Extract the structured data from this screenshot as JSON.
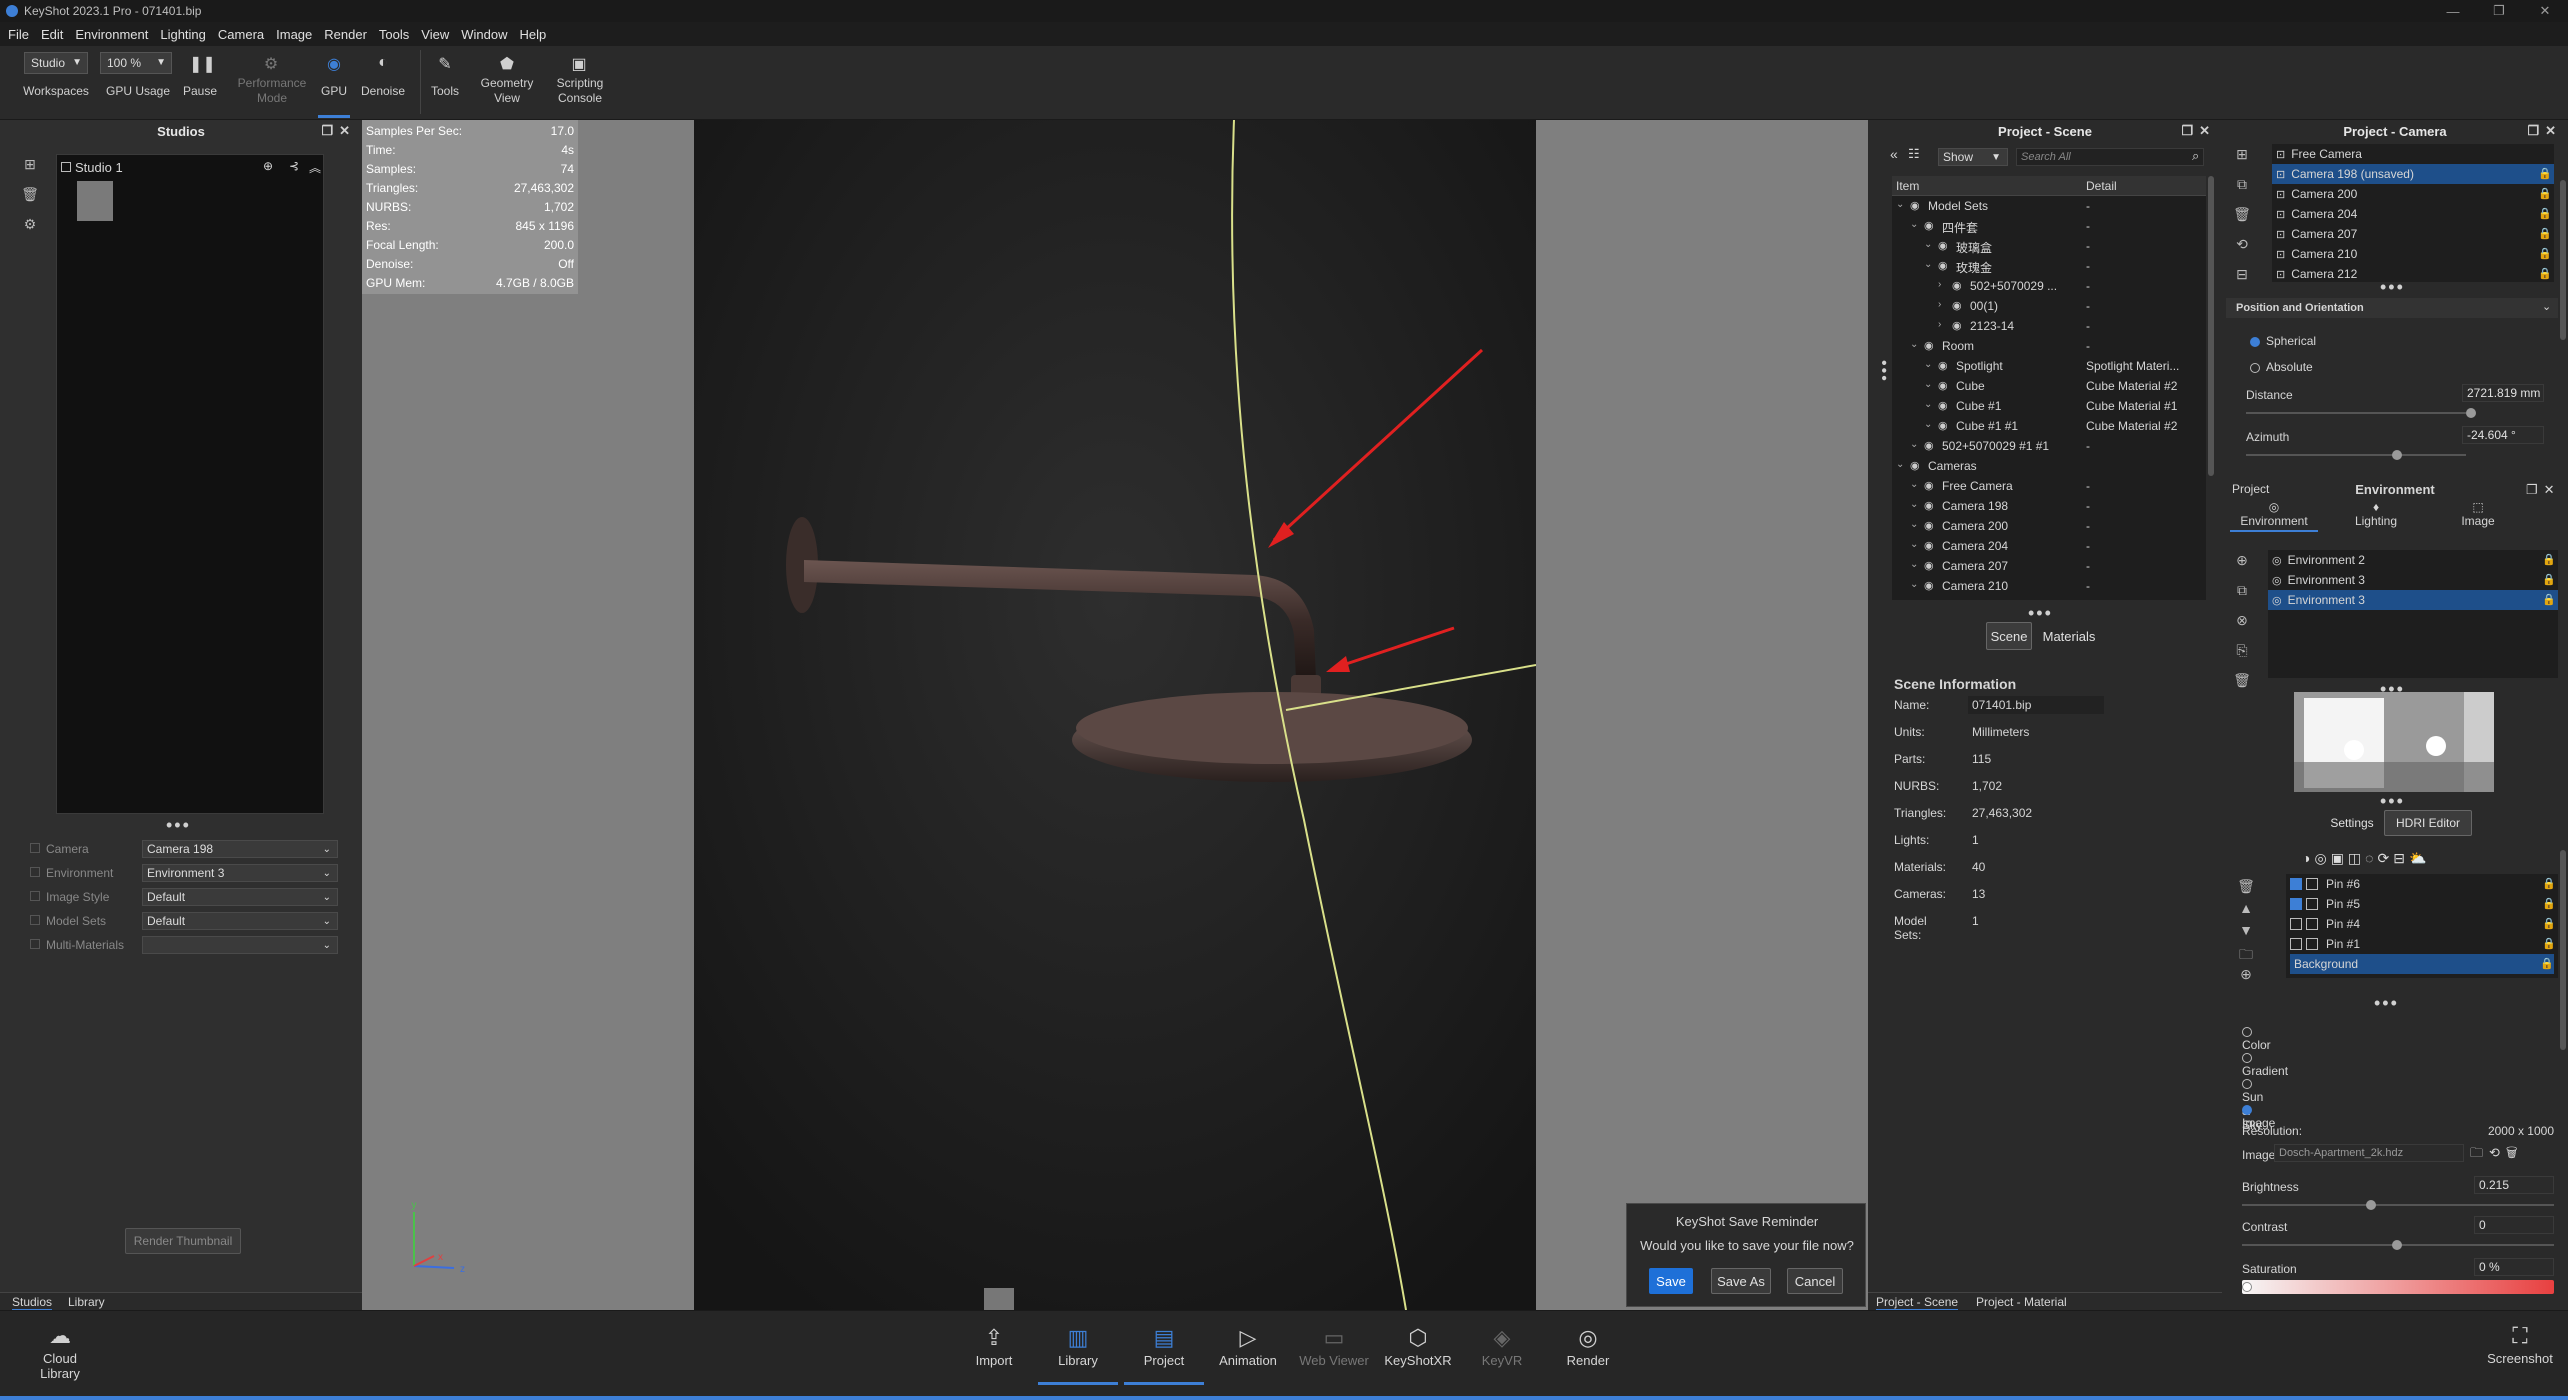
{
  "window": {
    "title": "KeyShot 2023.1 Pro - 071401.bip"
  },
  "menu": [
    "File",
    "Edit",
    "Environment",
    "Lighting",
    "Camera",
    "Image",
    "Render",
    "Tools",
    "View",
    "Window",
    "Help"
  ],
  "toolbar": {
    "workspace_value": "Studio",
    "workspace_label": "Workspaces",
    "gpu_usage_value": "100 %",
    "gpu_usage_label": "GPU Usage",
    "pause_label": "Pause",
    "perf_label_1": "Performance",
    "perf_label_2": "Mode",
    "gpu_label": "GPU",
    "denoise_label": "Denoise",
    "tools_label": "Tools",
    "geometry_label_1": "Geometry",
    "geometry_label_2": "View",
    "scripting_label_1": "Scripting",
    "scripting_label_2": "Console"
  },
  "studios": {
    "title": "Studios",
    "studio_name": "Studio 1",
    "fields": [
      {
        "label": "Camera",
        "value": "Camera 198"
      },
      {
        "label": "Environment",
        "value": "Environment 3"
      },
      {
        "label": "Image Style",
        "value": "Default"
      },
      {
        "label": "Model Sets",
        "value": "Default"
      },
      {
        "label": "Multi-Materials",
        "value": ""
      }
    ],
    "render_thumbnail": "Render Thumbnail",
    "tabs": [
      "Studios",
      "Library"
    ]
  },
  "stats": [
    {
      "k": "Samples Per Sec:",
      "v": "17.0"
    },
    {
      "k": "Time:",
      "v": "4s"
    },
    {
      "k": "Samples:",
      "v": "74"
    },
    {
      "k": "Triangles:",
      "v": "27,463,302"
    },
    {
      "k": "NURBS:",
      "v": "1,702"
    },
    {
      "k": "Res:",
      "v": "845 x 1196"
    },
    {
      "k": "Focal Length:",
      "v": "200.0"
    },
    {
      "k": "Denoise:",
      "v": "Off"
    },
    {
      "k": "GPU Mem:",
      "v": "4.7GB / 8.0GB"
    }
  ],
  "save_dialog": {
    "title": "KeyShot Save Reminder",
    "message": "Would you like to save your file now?",
    "save": "Save",
    "save_as": "Save As",
    "cancel": "Cancel"
  },
  "scene": {
    "title": "Project - Scene",
    "show_value": "Show",
    "search_placeholder": "Search All",
    "col_item": "Item",
    "col_detail": "Detail",
    "rows": [
      {
        "indent": 0,
        "name": "Model Sets",
        "detail": "-"
      },
      {
        "indent": 1,
        "name": "四件套",
        "detail": "-"
      },
      {
        "indent": 2,
        "name": "玻璃盒",
        "detail": "-"
      },
      {
        "indent": 2,
        "name": "玫瑰金",
        "detail": "-"
      },
      {
        "indent": 3,
        "name": "502+5070029 ...",
        "detail": "-"
      },
      {
        "indent": 3,
        "name": "00(1)",
        "detail": "-"
      },
      {
        "indent": 3,
        "name": "2123-14",
        "detail": "-"
      },
      {
        "indent": 1,
        "name": "Room",
        "detail": "-"
      },
      {
        "indent": 2,
        "name": "Spotlight",
        "detail": "Spotlight Materi..."
      },
      {
        "indent": 2,
        "name": "Cube",
        "detail": "Cube Material #2"
      },
      {
        "indent": 2,
        "name": "Cube #1",
        "detail": "Cube Material #1"
      },
      {
        "indent": 2,
        "name": "Cube #1 #1",
        "detail": "Cube Material #2"
      },
      {
        "indent": 1,
        "name": "502+5070029 #1 #1",
        "detail": "-"
      },
      {
        "indent": 0,
        "name": "Cameras",
        "detail": ""
      },
      {
        "indent": 1,
        "name": "Free Camera",
        "detail": "-"
      },
      {
        "indent": 1,
        "name": "Camera 198",
        "detail": "-"
      },
      {
        "indent": 1,
        "name": "Camera 200",
        "detail": "-"
      },
      {
        "indent": 1,
        "name": "Camera 204",
        "detail": "-"
      },
      {
        "indent": 1,
        "name": "Camera 207",
        "detail": "-"
      },
      {
        "indent": 1,
        "name": "Camera 210",
        "detail": "-"
      }
    ],
    "tab_scene": "Scene",
    "tab_materials": "Materials",
    "info_title": "Scene Information",
    "info": [
      {
        "k": "Name:",
        "v": "071401.bip"
      },
      {
        "k": "Units:",
        "v": "Millimeters"
      },
      {
        "k": "Parts:",
        "v": "115"
      },
      {
        "k": "NURBS:",
        "v": "1,702"
      },
      {
        "k": "Triangles:",
        "v": "27,463,302"
      },
      {
        "k": "Lights:",
        "v": "1"
      },
      {
        "k": "Materials:",
        "v": "40"
      },
      {
        "k": "Cameras:",
        "v": "13"
      },
      {
        "k": "Model Sets:",
        "v": "1"
      }
    ],
    "bottom_tabs": [
      "Project - Scene",
      "Project - Material"
    ]
  },
  "camera": {
    "title": "Project - Camera",
    "list": [
      "Free Camera",
      "Camera 198 (unsaved)",
      "Camera 200",
      "Camera 204",
      "Camera 207",
      "Camera 210",
      "Camera 212"
    ],
    "section": "Position and Orientation",
    "spherical": "Spherical",
    "absolute": "Absolute",
    "distance_label": "Distance",
    "distance_value": "2721.819 mm",
    "azimuth_label": "Azimuth",
    "azimuth_value": "-24.604 °"
  },
  "environment": {
    "project_label": "Project",
    "title": "Environment",
    "tabs": [
      "Environment",
      "Lighting",
      "Image"
    ],
    "list": [
      "Environment 2",
      "Environment 3",
      "Environment 3"
    ],
    "settings": "Settings",
    "hdri_editor": "HDRI Editor",
    "pins": [
      {
        "name": "Pin #6",
        "checked": true
      },
      {
        "name": "Pin #5",
        "checked": true
      },
      {
        "name": "Pin #4",
        "checked": false
      },
      {
        "name": "Pin #1",
        "checked": false
      }
    ],
    "background": "Background",
    "options": [
      "Color",
      "Gradient",
      "Sun & Sky",
      "Image"
    ],
    "resolution_label": "Resolution:",
    "resolution_value": "2000 x 1000",
    "image_label": "Image",
    "image_value": "Dosch-Apartment_2k.hdz",
    "brightness_label": "Brightness",
    "brightness_value": "0.215",
    "contrast_label": "Contrast",
    "contrast_value": "0",
    "saturation_label": "Saturation",
    "saturation_value": "0 %"
  },
  "bottom": {
    "cloud_1": "Cloud",
    "cloud_2": "Library",
    "buttons": [
      "Import",
      "Library",
      "Project",
      "Animation",
      "Web Viewer",
      "KeyShotXR",
      "KeyVR",
      "Render"
    ],
    "screenshot": "Screenshot"
  },
  "axis": {
    "y": "y",
    "x": "x",
    "z": "z"
  }
}
